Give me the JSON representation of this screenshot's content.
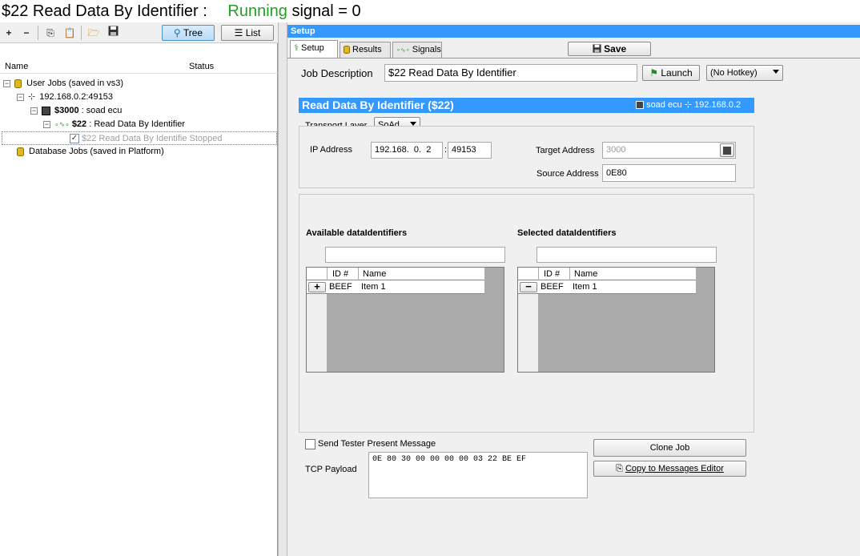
{
  "title": {
    "main": "$22 Read Data By Identifier :",
    "status": "Running",
    "signal": "signal = 0"
  },
  "left_toolbar": {
    "tree_label": "Tree",
    "list_label": "List"
  },
  "tree": {
    "columns": [
      "Name",
      "Status"
    ],
    "nodes": [
      {
        "label": "User Jobs (saved in vs3)"
      },
      {
        "label": "192.168.0.2:49153"
      },
      {
        "bold": "$3000",
        "label": " : soad ecu"
      },
      {
        "bold": "$22",
        "label": " : Read Data By Identifier"
      },
      {
        "label": "$22 Read Data By Identifie Stopped"
      },
      {
        "label": "Database Jobs (saved in Platform)"
      }
    ]
  },
  "setup": {
    "header": "Setup",
    "tabs": [
      "Setup",
      "Results",
      "Signals"
    ],
    "save_label": "Save",
    "job_description_label": "Job Description",
    "job_description_value": "$22 Read Data By Identifier",
    "launch_label": "Launch",
    "hotkey_value": "(No Hotkey)"
  },
  "service": {
    "title": "Read Data By Identifier ($22)",
    "ecu_label": "soad ecu",
    "ip_label": "192.168.0.2",
    "transport_layer_label": "Transport Layer",
    "transport_layer_value": "SoAd",
    "ip_address_label": "IP Address",
    "ip_address_value": "192.168.  0.  2",
    "port_separator": ":",
    "port_value": "49153",
    "target_address_label": "Target Address",
    "target_address_value": "3000",
    "source_address_label": "Source Address",
    "source_address_value": "0E80"
  },
  "identifiers": {
    "available_label": "Available dataIdentifiers",
    "selected_label": "Selected dataIdentifiers",
    "col_id": "ID #",
    "col_name": "Name",
    "available_rows": [
      {
        "id": "BEEF",
        "name": "Item 1"
      }
    ],
    "selected_rows": [
      {
        "id": "BEEF",
        "name": "Item 1"
      }
    ]
  },
  "bottom": {
    "tester_present_label": "Send Tester Present Message",
    "clone_job_label": "Clone Job",
    "copy_label": "Copy to Messages Editor",
    "tcp_payload_label": "TCP Payload",
    "tcp_payload_value": "0E 80 30 00 00 00 00 03 22 BE EF"
  },
  "colors": {
    "accent": "#3399ff",
    "running": "#22a022"
  }
}
